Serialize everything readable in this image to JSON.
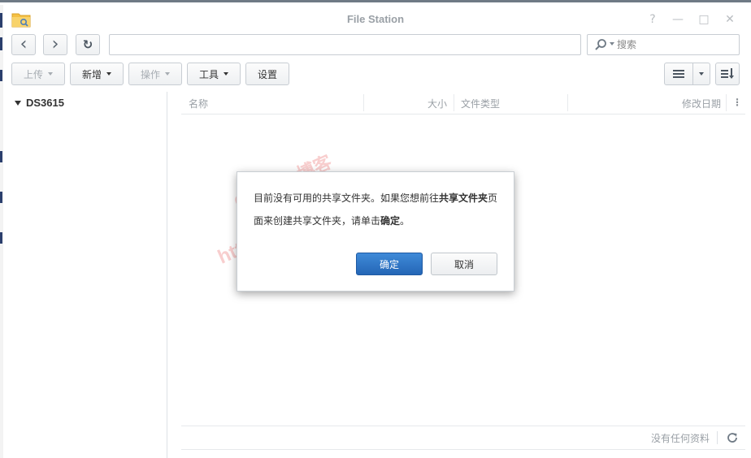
{
  "window": {
    "title": "File Station",
    "controls": {
      "help": "?",
      "minimize": "—",
      "maximize": "□",
      "close": "✕"
    }
  },
  "nav": {
    "back_icon": "‹",
    "forward_icon": "›",
    "refresh_icon": "↻",
    "path": "",
    "search_placeholder": "搜索"
  },
  "toolbar": {
    "upload": "上传",
    "create": "新增",
    "action": "操作",
    "tools": "工具",
    "settings": "设置"
  },
  "sidebar": {
    "root": "DS3615"
  },
  "columns": {
    "name": "名称",
    "size": "大小",
    "type": "文件类型",
    "modified": "修改日期",
    "more": "⋮"
  },
  "footer": {
    "status": "没有任何资料"
  },
  "dialog": {
    "message_part1": "目前没有可用的共享文件夹。如果您想前往",
    "message_bold1": "共享文件夹",
    "message_part2": "页面来创建共享文件夹，请单击",
    "message_bold2": "确定",
    "message_part3": "。",
    "ok": "确定",
    "cancel": "取消"
  },
  "watermark": {
    "line1": "GXNAS 博客",
    "line2": "https://wp.gxnas.com"
  },
  "colors": {
    "primary_button": "#2466b6",
    "title_text": "#9aa0a6",
    "watermark": "#e65050"
  }
}
